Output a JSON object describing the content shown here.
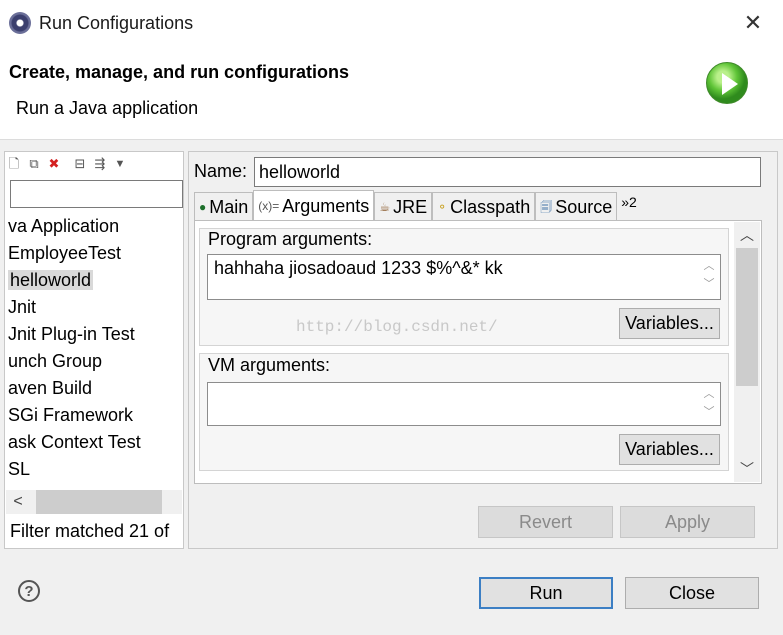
{
  "window": {
    "title": "Run Configurations",
    "close_glyph": "✕"
  },
  "banner": {
    "title": "Create, manage, and run configurations",
    "subtitle": "Run a Java application"
  },
  "left": {
    "toolbar_icons": [
      "new-config-icon",
      "duplicate-icon",
      "delete-icon",
      "collapse-all-icon",
      "filter-icon",
      "dropdown-icon"
    ],
    "filter_value": "",
    "items": [
      {
        "label": "va Application"
      },
      {
        "label": "EmployeeTest"
      },
      {
        "label": "helloworld"
      },
      {
        "label": "Jnit"
      },
      {
        "label": "Jnit Plug-in Test"
      },
      {
        "label": "unch Group"
      },
      {
        "label": "aven Build"
      },
      {
        "label": "SGi Framework"
      },
      {
        "label": "ask Context Test"
      },
      {
        "label": "SL"
      }
    ],
    "hscroll_left": "<",
    "filter_status": "Filter matched 21 of"
  },
  "right": {
    "name_label": "Name:",
    "name_value": "helloworld",
    "tabs": [
      "Main",
      "Arguments",
      "JRE",
      "Classpath",
      "Source"
    ],
    "tab_overflow": "»2",
    "program_args": {
      "label": "Program arguments:",
      "value": "hahhaha jiosadoaud 1233 $%^&* kk",
      "variables_label": "Variables..."
    },
    "vm_args": {
      "label": "VM arguments:",
      "value": "",
      "variables_label": "Variables..."
    },
    "watermark": "http://blog.csdn.net/",
    "revert_label": "Revert",
    "apply_label": "Apply"
  },
  "footer": {
    "help": "?",
    "run_label": "Run",
    "close_label": "Close"
  },
  "scroll_glyphs": {
    "up": "︿",
    "down": "﹀"
  }
}
